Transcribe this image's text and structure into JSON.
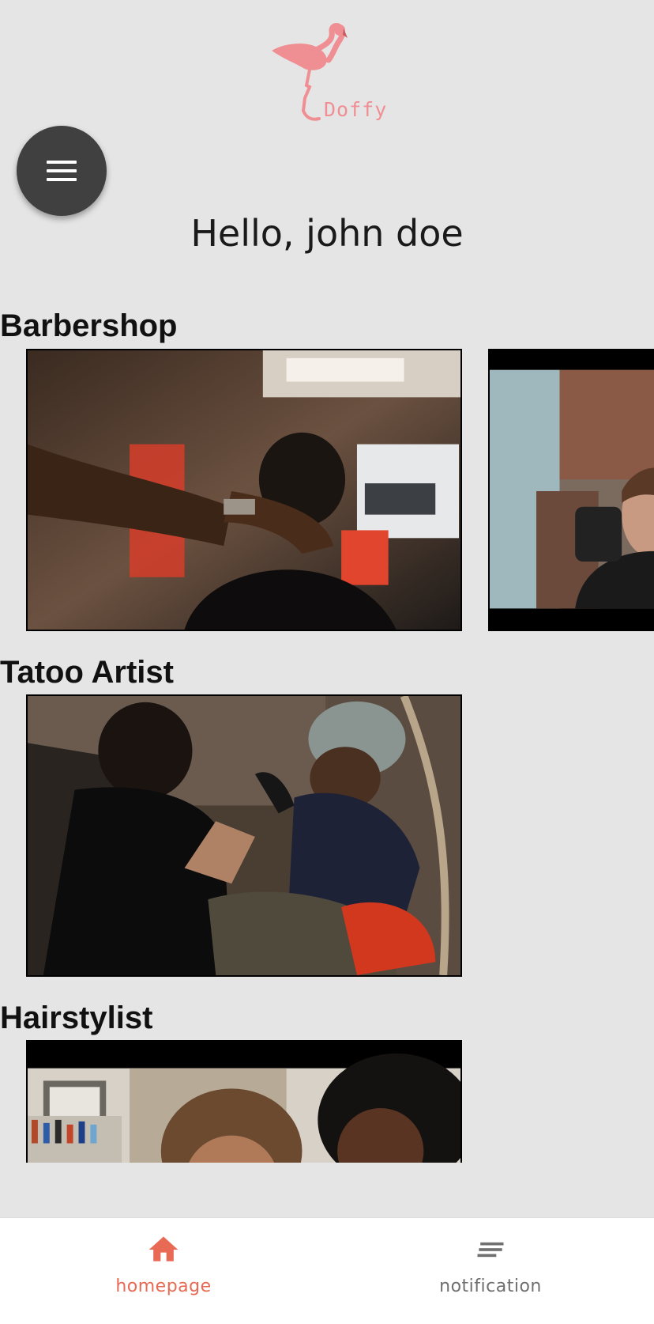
{
  "app": {
    "logo_text": "Doffy",
    "accent_color": "#e86a54",
    "logo_color": "#f08f93"
  },
  "header": {
    "greeting": "Hello, john doe",
    "menu_icon": "hamburger-menu-icon"
  },
  "sections": [
    {
      "title": "Barbershop"
    },
    {
      "title": "Tatoo Artist"
    },
    {
      "title": "Hairstylist"
    }
  ],
  "bottom_nav": {
    "items": [
      {
        "label": "homepage",
        "icon": "home-icon",
        "active": true
      },
      {
        "label": "notification",
        "icon": "notification-lines-icon",
        "active": false
      }
    ]
  }
}
